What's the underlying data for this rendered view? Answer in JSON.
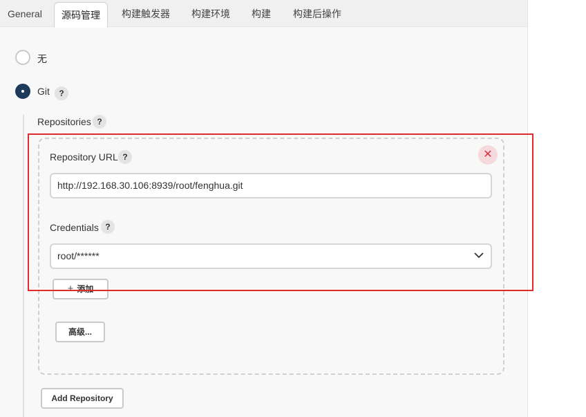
{
  "tabs": [
    {
      "label": "General"
    },
    {
      "label": "源码管理",
      "active": true
    },
    {
      "label": "构建触发器"
    },
    {
      "label": "构建环境"
    },
    {
      "label": "构建"
    },
    {
      "label": "构建后操作"
    }
  ],
  "scm": {
    "options": [
      {
        "label": "无",
        "selected": false
      },
      {
        "label": "Git",
        "selected": true,
        "help": "?"
      }
    ]
  },
  "repositories": {
    "label": "Repositories",
    "help": "?",
    "repository_url": {
      "label": "Repository URL",
      "help": "?",
      "value": "http://192.168.30.106:8939/root/fenghua.git"
    },
    "credentials": {
      "label": "Credentials",
      "help": "?",
      "selected": "root/******"
    },
    "delete_icon": "close-icon",
    "add_button": "添加",
    "advanced_button": "高级...",
    "add_repository_button": "Add Repository"
  },
  "colors": {
    "highlight": "#e02b2b",
    "radio_selected": "#1d3a5a",
    "delete": "#d6323f"
  }
}
